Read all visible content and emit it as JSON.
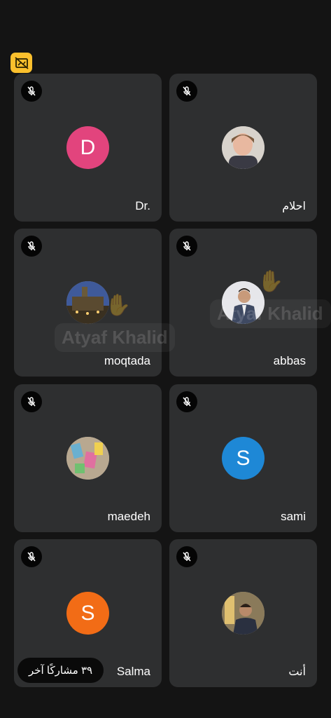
{
  "colors": {
    "background": "#141414",
    "tile": "#2e2f30",
    "badge": "#fbc02d"
  },
  "badge": {
    "icon": "no-video-layout-icon"
  },
  "tiles": [
    {
      "name": "Dr.",
      "avatar_type": "letter",
      "letter": "D",
      "color": "#e2447d",
      "muted": true
    },
    {
      "name": "احلام",
      "avatar_type": "photo",
      "muted": true
    },
    {
      "name": "moqtada",
      "avatar_type": "photo",
      "muted": true
    },
    {
      "name": "abbas",
      "avatar_type": "photo",
      "muted": true
    },
    {
      "name": "maedeh",
      "avatar_type": "photo",
      "muted": true
    },
    {
      "name": "sami",
      "avatar_type": "letter",
      "letter": "S",
      "color": "#1e88d6",
      "muted": true
    },
    {
      "name": "Salma",
      "avatar_type": "letter",
      "letter": "S",
      "color": "#f26c16",
      "muted": true
    },
    {
      "name": "أنت",
      "avatar_type": "photo",
      "muted": true
    }
  ],
  "others_chip": "٣٩ مشاركًا آخر",
  "overlay_name": "Atyaf Khalid"
}
